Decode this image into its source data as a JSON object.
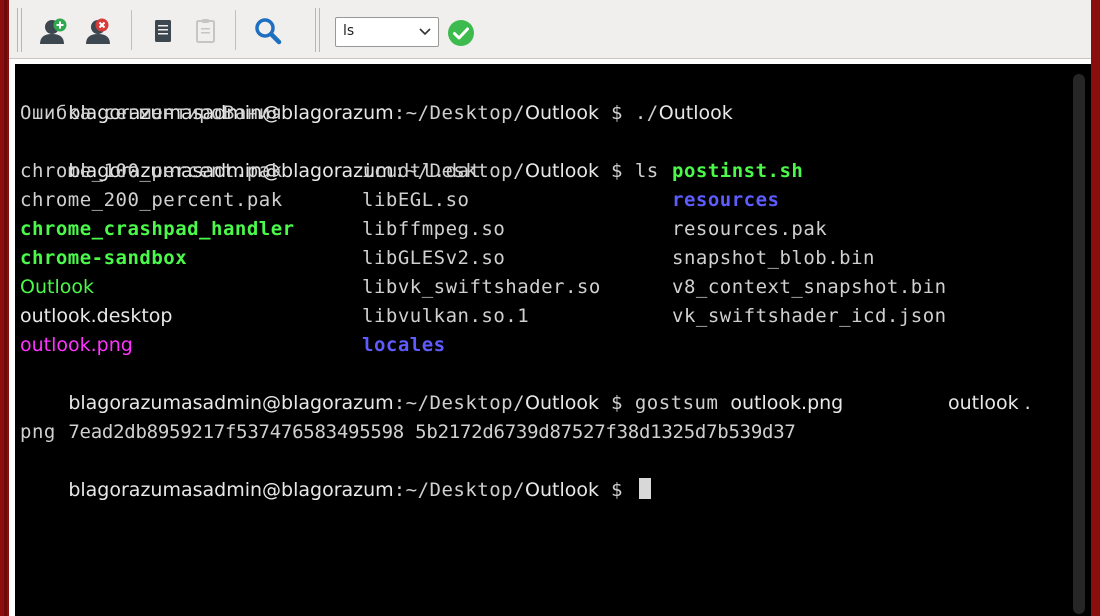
{
  "toolbar": {
    "icons": [
      "add-user-icon",
      "remove-user-icon",
      "copy-icon",
      "paste-icon",
      "search-icon"
    ],
    "command_select": {
      "value": "ls",
      "icon": "chevron-down-icon"
    },
    "run_icon": "check-circle-icon",
    "colors": {
      "window_frame": "#8b0e0e",
      "toolbar_bg": "#f0efee",
      "run_green": "#3dbb4e"
    }
  },
  "terminal": {
    "colors": {
      "background": "#000000",
      "text": "#d0d0d0",
      "executable": "#4af94a",
      "directory": "#5e5cff",
      "image": "#ff33ff"
    },
    "prompt": {
      "userhost": "blagorazumasadmin@blagorazum",
      "path_prefix": ":~/Desktop/",
      "path_dir": "Outlook",
      "symbol": " $ "
    },
    "cmd1": {
      "arg1": "./",
      "arg2": "Outlook"
    },
    "error_line": "Ошибка сегментироВания",
    "cmd2": "ls",
    "listing": [
      [
        "chrome_100_percent.pak",
        "icudtl.dat",
        "postinst.sh"
      ],
      [
        "chrome_200_percent.pak",
        "libEGL.so",
        "resources"
      ],
      [
        "chrome_crashpad_handler",
        "libffmpeg.so",
        "resources.pak"
      ],
      [
        "chrome-sandbox",
        "libGLESv2.so",
        "snapshot_blob.bin"
      ],
      [
        "Outlook",
        "libvk_swiftshader.so",
        "v8_context_snapshot.bin"
      ],
      [
        "outlook.desktop",
        "libvulkan.so.1",
        "vk_swiftshader_icd.json"
      ],
      [
        "outlook.png",
        "locales",
        ""
      ]
    ],
    "cmd3": {
      "tool": "gostsum",
      "arg": "outlook.png"
    },
    "hash_line": "7ead2db8959217f537476583495598 5b2172d6739d87527f38d1325d7b539d37",
    "hash_file_part1": "outlook .",
    "hash_file_part2": "png"
  }
}
